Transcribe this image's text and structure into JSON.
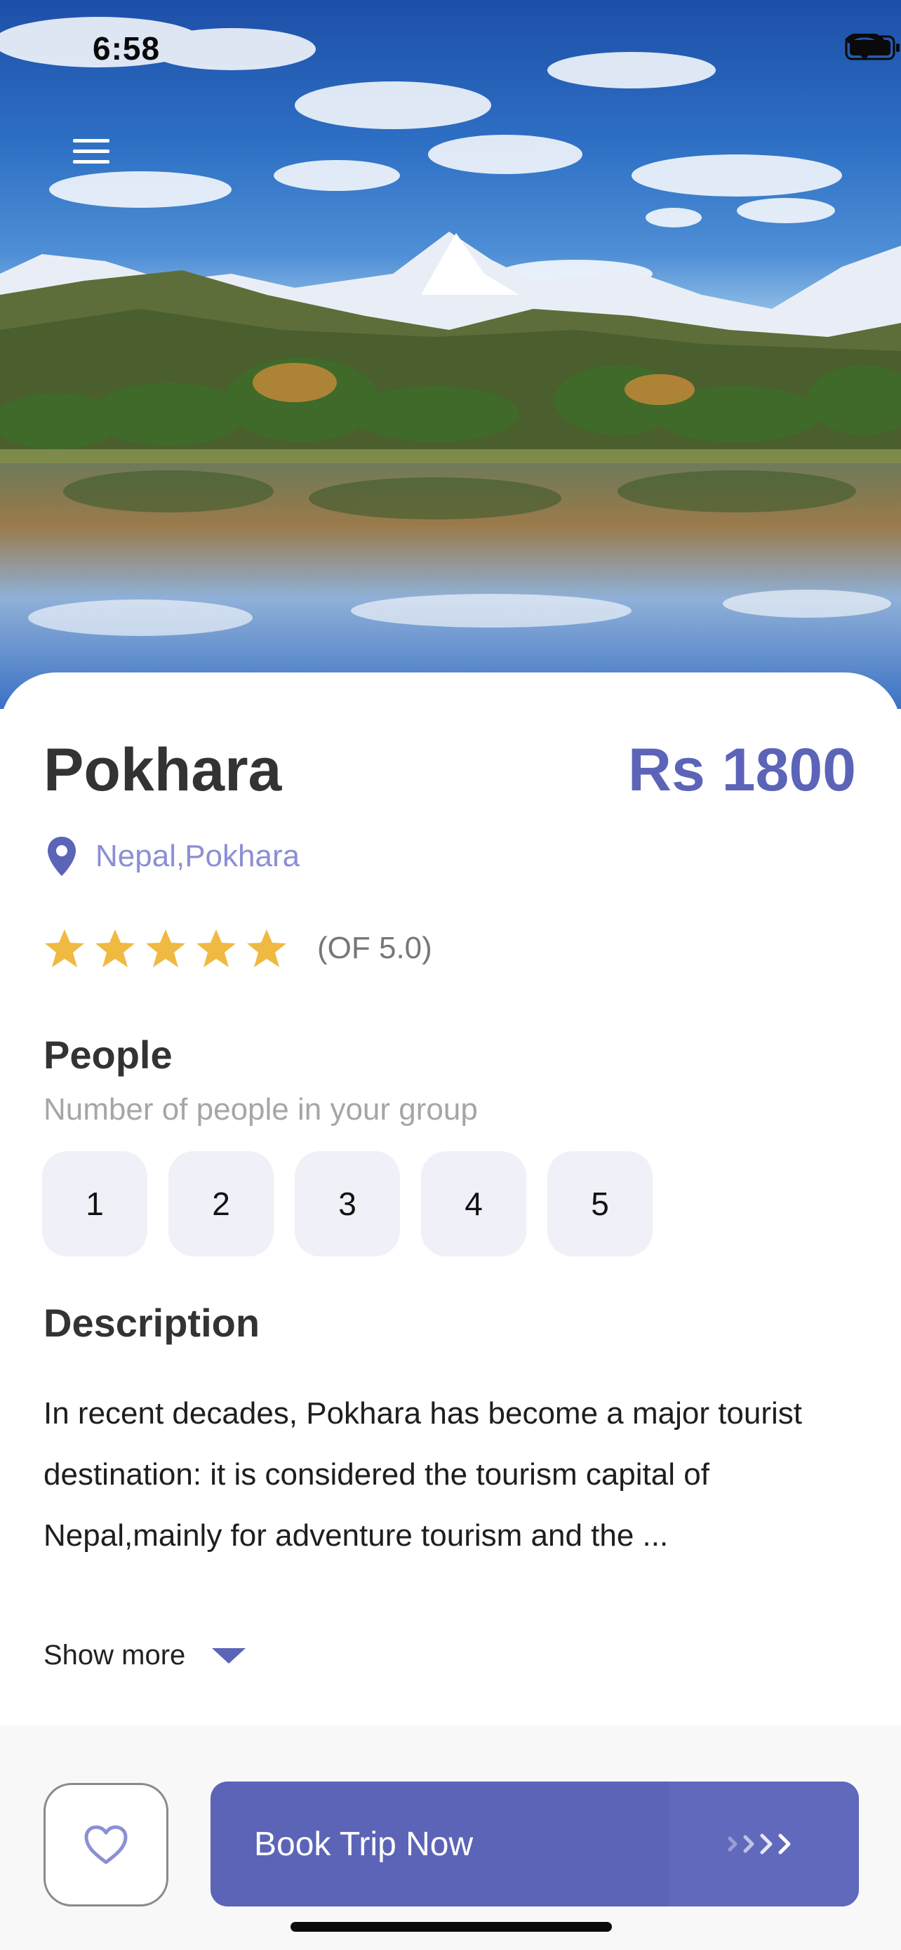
{
  "status_bar": {
    "time": "6:58",
    "icons": [
      "cellular-dots-icon",
      "wifi-icon",
      "battery-icon"
    ]
  },
  "header": {
    "menu_icon": "hamburger-menu-icon"
  },
  "destination": {
    "title": "Pokhara",
    "price": "Rs 1800",
    "location_icon": "location-pin-icon",
    "location": "Nepal,Pokhara",
    "rating": {
      "stars": 5,
      "max": 5,
      "label": "(OF 5.0)"
    }
  },
  "people": {
    "heading": "People",
    "subtitle": "Number of people in your group",
    "options": [
      "1",
      "2",
      "3",
      "4",
      "5"
    ]
  },
  "description": {
    "heading": "Description",
    "text": "In recent decades, Pokhara has become a major tourist destination: it is considered the tourism capital of Nepal,mainly for adventure tourism and the ...",
    "show_more": "Show more",
    "show_more_icon": "caret-down-icon"
  },
  "actions": {
    "favorite_icon": "heart-outline-icon",
    "book_label": "Book Trip Now",
    "book_icon": "chevrons-right-icon"
  },
  "colors": {
    "accent": "#5c64b8",
    "location_text": "#8b8fd4",
    "star": "#f0b942",
    "chip_bg": "#f0f0f8"
  }
}
